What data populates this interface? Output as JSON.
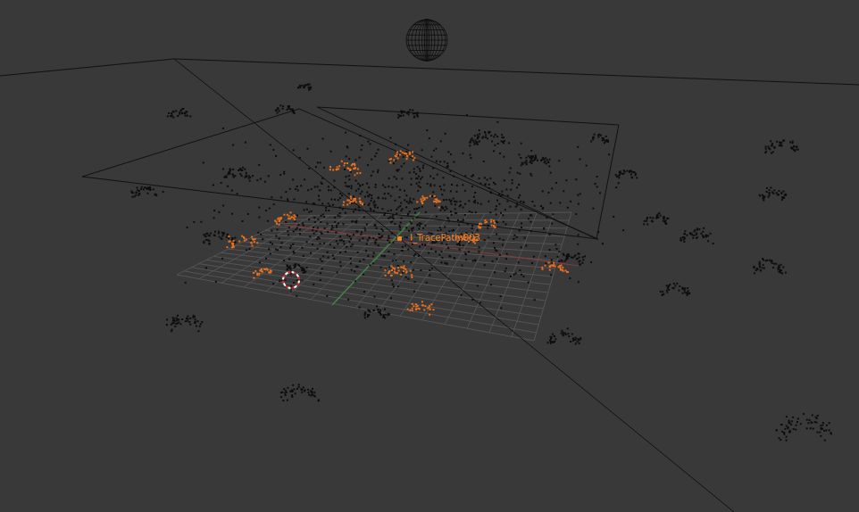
{
  "viewport": {
    "object_label": "I_TracePath.003",
    "object_selected": true
  }
}
